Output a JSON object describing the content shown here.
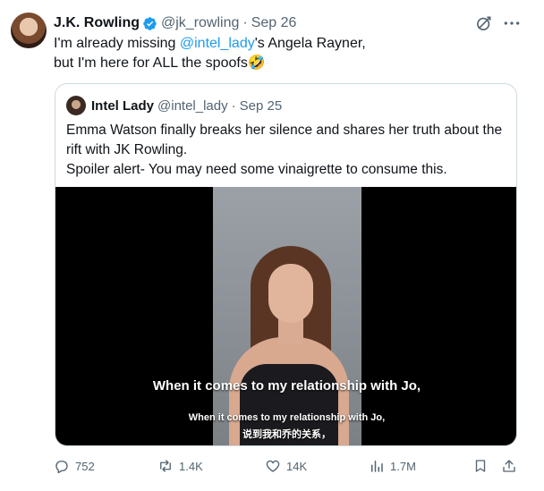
{
  "tweet": {
    "author_name": "J.K. Rowling",
    "handle": "@jk_rowling",
    "separator": "·",
    "date": "Sep 26",
    "text_line1_pre": "I'm already missing ",
    "text_line1_mention": "@intel_lady",
    "text_line1_post": "'s Angela Rayner,",
    "text_line2": "but I'm here for ALL the spoofs🤣",
    "icons": {
      "verified": "verified-badge-icon",
      "grok": "grok-icon",
      "more": "more-icon"
    },
    "colors": {
      "accent": "#1d9bf0",
      "muted": "#536471",
      "text": "#0f1419",
      "border": "#cfd9de"
    }
  },
  "quote": {
    "author_name": "Intel Lady",
    "handle": "@intel_lady",
    "separator": "·",
    "date": "Sep 25",
    "text_line1": "Emma Watson finally breaks her silence and shares her truth about the",
    "text_line2": "rift with JK Rowling.",
    "text_line3": "Spoiler alert- You may need some vinaigrette to consume this.",
    "video": {
      "subtitle_large": "When it comes to my relationship with Jo,",
      "subtitle_small": "When it comes to my relationship with Jo,",
      "subtitle_chinese": "说到我和乔的关系，"
    }
  },
  "actions": {
    "replies": "752",
    "reposts": "1.4K",
    "likes": "14K",
    "views": "1.7M",
    "icons": [
      "reply-icon",
      "repost-icon",
      "like-icon",
      "views-icon",
      "bookmark-icon",
      "share-icon"
    ]
  }
}
